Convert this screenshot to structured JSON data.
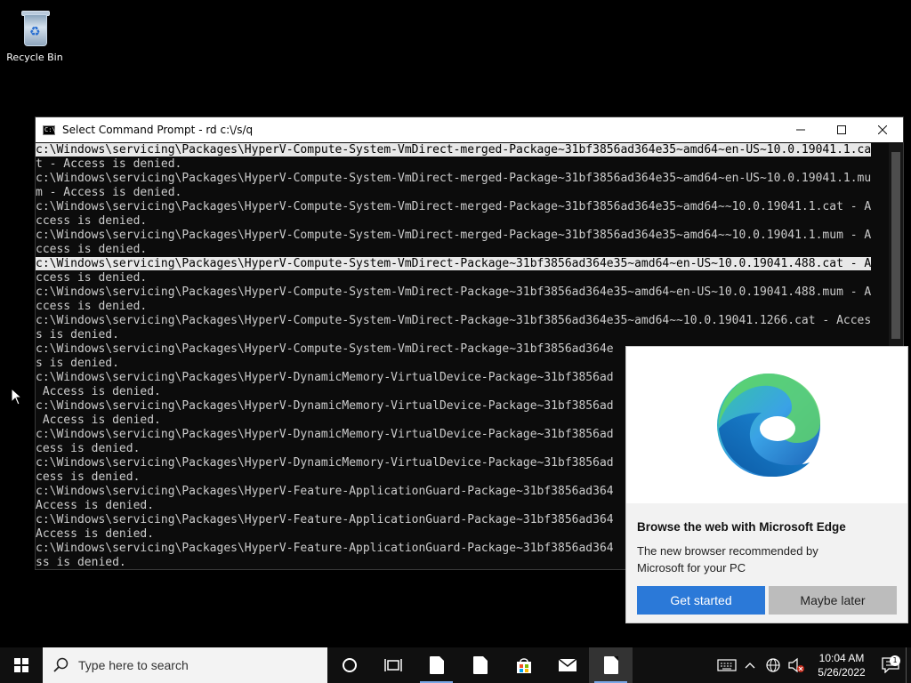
{
  "desktop": {
    "recycle_bin_label": "Recycle Bin"
  },
  "console": {
    "title": "Select Command Prompt - rd  c:\\/s/q",
    "lines": [
      "c:\\Windows\\servicing\\Packages\\HyperV-Compute-System-VmDirect-merged-Package~31bf3856ad364e35~amd64~en-US~10.0.19041.1.ca",
      "t - Access is denied.",
      "c:\\Windows\\servicing\\Packages\\HyperV-Compute-System-VmDirect-merged-Package~31bf3856ad364e35~amd64~en-US~10.0.19041.1.mu",
      "m - Access is denied.",
      "c:\\Windows\\servicing\\Packages\\HyperV-Compute-System-VmDirect-merged-Package~31bf3856ad364e35~amd64~~10.0.19041.1.cat - A",
      "ccess is denied.",
      "c:\\Windows\\servicing\\Packages\\HyperV-Compute-System-VmDirect-merged-Package~31bf3856ad364e35~amd64~~10.0.19041.1.mum - A",
      "ccess is denied.",
      "c:\\Windows\\servicing\\Packages\\HyperV-Compute-System-VmDirect-Package~31bf3856ad364e35~amd64~en-US~10.0.19041.488.cat - A",
      "ccess is denied.",
      "c:\\Windows\\servicing\\Packages\\HyperV-Compute-System-VmDirect-Package~31bf3856ad364e35~amd64~en-US~10.0.19041.488.mum - A",
      "ccess is denied.",
      "c:\\Windows\\servicing\\Packages\\HyperV-Compute-System-VmDirect-Package~31bf3856ad364e35~amd64~~10.0.19041.1266.cat - Acces",
      "s is denied.",
      "c:\\Windows\\servicing\\Packages\\HyperV-Compute-System-VmDirect-Package~31bf3856ad364e",
      "s is denied.",
      "c:\\Windows\\servicing\\Packages\\HyperV-DynamicMemory-VirtualDevice-Package~31bf3856ad",
      " Access is denied.",
      "c:\\Windows\\servicing\\Packages\\HyperV-DynamicMemory-VirtualDevice-Package~31bf3856ad",
      " Access is denied.",
      "c:\\Windows\\servicing\\Packages\\HyperV-DynamicMemory-VirtualDevice-Package~31bf3856ad",
      "cess is denied.",
      "c:\\Windows\\servicing\\Packages\\HyperV-DynamicMemory-VirtualDevice-Package~31bf3856ad",
      "cess is denied.",
      "c:\\Windows\\servicing\\Packages\\HyperV-Feature-ApplicationGuard-Package~31bf3856ad364",
      "Access is denied.",
      "c:\\Windows\\servicing\\Packages\\HyperV-Feature-ApplicationGuard-Package~31bf3856ad364",
      "Access is denied.",
      "c:\\Windows\\servicing\\Packages\\HyperV-Feature-ApplicationGuard-Package~31bf3856ad364",
      "ss is denied."
    ]
  },
  "edge_promo": {
    "title": "Browse the web with Microsoft Edge",
    "description": "The new browser recommended by Microsoft for your PC",
    "primary_button": "Get started",
    "secondary_button": "Maybe later"
  },
  "taskbar": {
    "search_placeholder": "Type here to search",
    "time": "10:04 AM",
    "date": "5/26/2022",
    "notification_count": "1"
  },
  "colors": {
    "console_bg": "#0c0c0c",
    "console_fg": "#cccccc",
    "accent": "#2b79d8",
    "taskbar_bg": "#101010"
  }
}
